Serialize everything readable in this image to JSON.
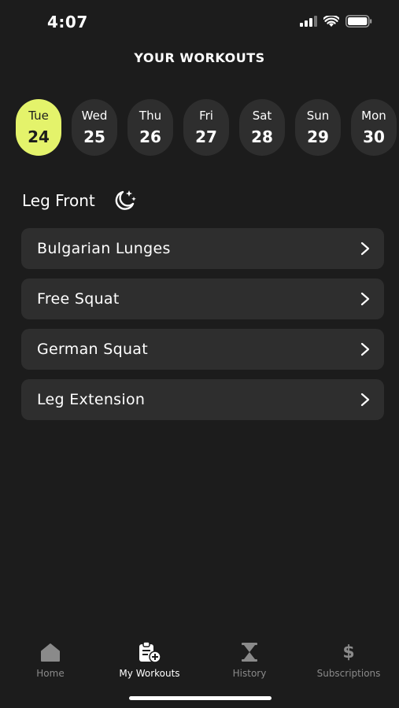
{
  "status": {
    "time": "4:07"
  },
  "header": {
    "title": "YOUR WORKOUTS"
  },
  "days": [
    {
      "name": "Tue",
      "num": "24",
      "selected": true
    },
    {
      "name": "Wed",
      "num": "25",
      "selected": false
    },
    {
      "name": "Thu",
      "num": "26",
      "selected": false
    },
    {
      "name": "Fri",
      "num": "27",
      "selected": false
    },
    {
      "name": "Sat",
      "num": "28",
      "selected": false
    },
    {
      "name": "Sun",
      "num": "29",
      "selected": false
    },
    {
      "name": "Mon",
      "num": "30",
      "selected": false
    }
  ],
  "section": {
    "title": "Leg Front",
    "icon": "moon-stars-icon"
  },
  "workouts": [
    {
      "label": "Bulgarian Lunges"
    },
    {
      "label": "Free Squat"
    },
    {
      "label": "German Squat"
    },
    {
      "label": "Leg Extension"
    }
  ],
  "tabs": [
    {
      "label": "Home",
      "icon": "home-icon",
      "active": false
    },
    {
      "label": "My Workouts",
      "icon": "clipboard-plus-icon",
      "active": true
    },
    {
      "label": "History",
      "icon": "hourglass-icon",
      "active": false
    },
    {
      "label": "Subscriptions",
      "icon": "dollar-icon",
      "active": false
    }
  ],
  "colors": {
    "background": "#1c1c1c",
    "card": "#2e2e2e",
    "accent": "#e4f36b",
    "inactive": "#8a8a8a"
  }
}
